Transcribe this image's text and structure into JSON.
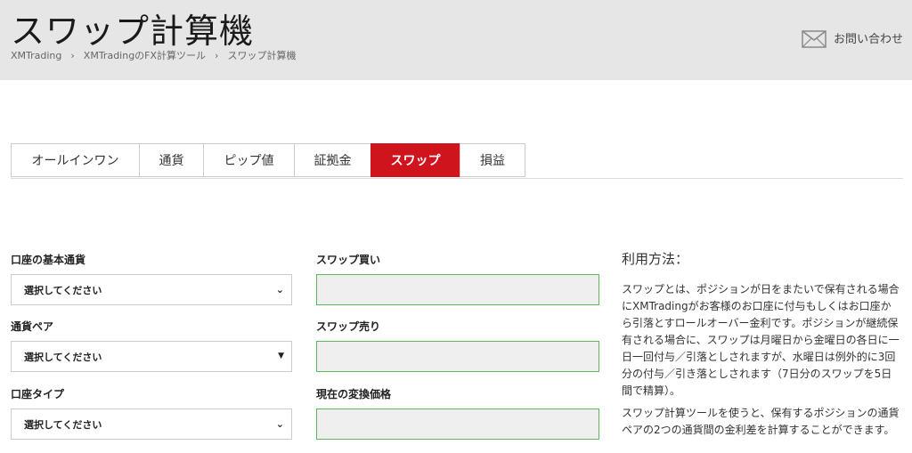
{
  "header": {
    "title": "スワップ計算機",
    "breadcrumb": [
      "XMTrading",
      "XMTradingのFX計算ツール",
      "スワップ計算機"
    ],
    "contact_label": "お問い合わせ",
    "contact_icon": "envelope-icon"
  },
  "tabs": [
    {
      "label": "オールインワン",
      "active": false
    },
    {
      "label": "通貨",
      "active": false
    },
    {
      "label": "ピップ値",
      "active": false
    },
    {
      "label": "証拠金",
      "active": false
    },
    {
      "label": "スワップ",
      "active": true
    },
    {
      "label": "損益",
      "active": false
    }
  ],
  "form": {
    "base_currency_label": "口座の基本通貨",
    "base_currency_value": "選択してください",
    "pair_label": "通貨ペア",
    "pair_value": "選択してください",
    "account_type_label": "口座タイプ",
    "account_type_value": "選択してください"
  },
  "results": {
    "swap_buy_label": "スワップ買い",
    "swap_sell_label": "スワップ売り",
    "rate_label": "現在の変換価格"
  },
  "howto": {
    "title": "利用方法：",
    "p1": "スワップとは、ポジションが日をまたいで保有される場合にXMTradingがお客様のお口座に付与もしくはお口座から引落とすロールオーバー金利です。ポジションが継続保有される場合に、スワップは月曜日から金曜日の各日に一日一回付与／引落としされますが、水曜日は例外的に3回分の付与／引き落としされます（7日分のスワップを5日間で精算）。",
    "p2": "スワップ計算ツールを使うと、保有するポジションの通貨ペアの2つの通貨間の金利差を計算することができます。"
  },
  "colors": {
    "accent": "#d0141e",
    "result_border": "#5cb85c",
    "header_bg": "#e6e6e6"
  }
}
